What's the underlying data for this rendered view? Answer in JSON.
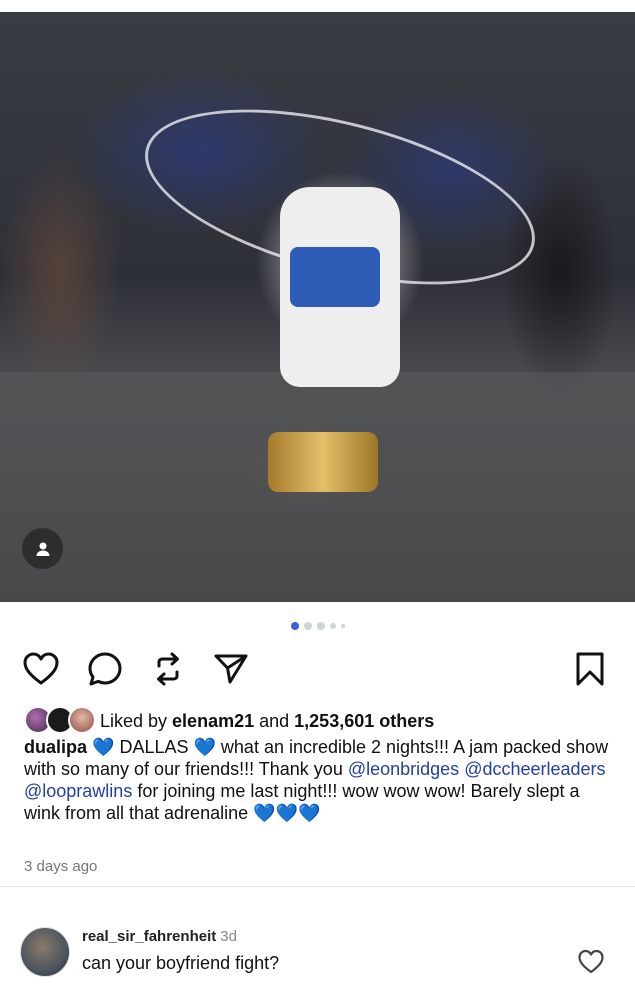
{
  "post": {
    "image_alt_icon": "person-tag-icon",
    "carousel": {
      "total": 5,
      "active_index": 0
    }
  },
  "actions": {
    "like_icon": "heart-icon",
    "comment_icon": "comment-bubble-icon",
    "repost_icon": "repost-icon",
    "share_icon": "send-icon",
    "save_icon": "bookmark-icon"
  },
  "likes": {
    "prefix": "Liked by ",
    "user": "elenam21",
    "middle": " and ",
    "others": "1,253,601 others"
  },
  "caption": {
    "username": "dualipa",
    "heart": "💙",
    "dallas": " DALLAS ",
    "part1": " what an incredible 2 nights!!! A jam packed show with so many of our friends!!! Thank you ",
    "mention1": "@leonbridges",
    "mention2": "@dccheerleaders",
    "mention3": "@looprawlins",
    "part2": " for joining me last night!!! wow wow wow! Barely slept a wink from all that adrenaline ",
    "end_hearts": "💙💙💙"
  },
  "time_ago": "3 days ago",
  "comment": {
    "username": "real_sir_fahrenheit",
    "time": "3d",
    "text": "can your boyfriend fight?"
  },
  "colors": {
    "accent": "#3a62e0",
    "mention": "#2340a8",
    "heart_blue": "#1f8cff"
  }
}
